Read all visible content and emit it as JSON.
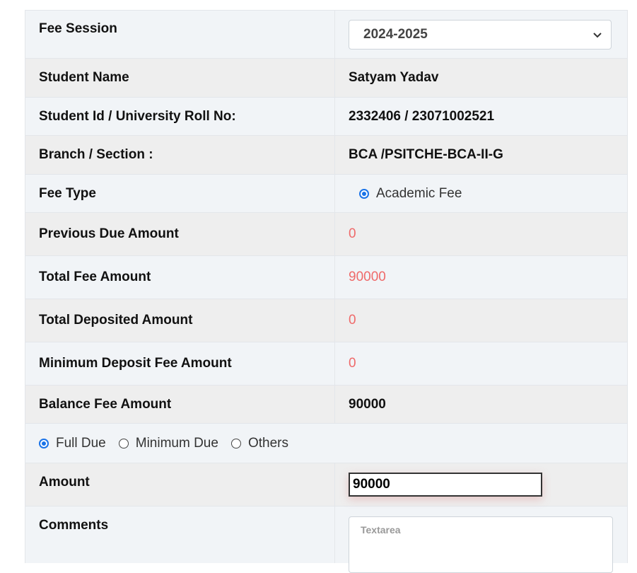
{
  "fee_session": {
    "label": "Fee Session",
    "selected": "2024-2025"
  },
  "student_name": {
    "label": "Student Name",
    "value": "Satyam Yadav"
  },
  "student_id": {
    "label": "Student Id / University Roll No:",
    "value": "2332406 / 23071002521"
  },
  "branch": {
    "label": "Branch / Section :",
    "value": "BCA /PSITCHE-BCA-II-G"
  },
  "fee_type": {
    "label": "Fee Type",
    "option": "Academic Fee",
    "selected": true
  },
  "previous_due": {
    "label": "Previous Due Amount",
    "value": "0"
  },
  "total_fee": {
    "label": "Total Fee Amount",
    "value": "90000"
  },
  "total_deposited": {
    "label": "Total Deposited Amount",
    "value": "0"
  },
  "minimum_deposit": {
    "label": "Minimum Deposit Fee Amount",
    "value": "0"
  },
  "balance_fee": {
    "label": "Balance Fee Amount",
    "value": "90000"
  },
  "due_options": {
    "items": [
      {
        "label": "Full Due",
        "selected": true
      },
      {
        "label": "Minimum Due",
        "selected": false
      },
      {
        "label": "Others",
        "selected": false
      }
    ]
  },
  "amount": {
    "label": "Amount",
    "value": "90000"
  },
  "comments": {
    "label": "Comments",
    "placeholder": "Textarea"
  },
  "colors": {
    "accent": "#1a73e8",
    "amount_red": "#ef6a6a"
  }
}
